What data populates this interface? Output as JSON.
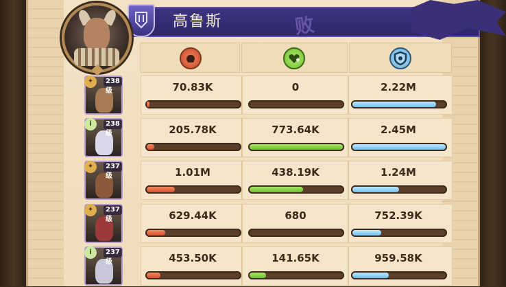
{
  "hero": {
    "name": "高鲁斯",
    "result_glyph": "败"
  },
  "columns": [
    {
      "icon": "damage-fist-icon",
      "color": "#e0593a"
    },
    {
      "icon": "healing-heart-icon",
      "color": "#79c13a"
    },
    {
      "icon": "damage-taken-shield-icon",
      "color": "#5aa9d9"
    }
  ],
  "rows": [
    {
      "level": "238级",
      "faction": "star",
      "damage": "70.83K",
      "damage_ratio": 0.03,
      "healing": "0",
      "healing_ratio": 0.0,
      "taken": "2.22M",
      "taken_ratio": 0.9
    },
    {
      "level": "238级",
      "faction": "1",
      "damage": "205.78K",
      "damage_ratio": 0.08,
      "healing": "773.64K",
      "healing_ratio": 1.0,
      "taken": "2.45M",
      "taken_ratio": 1.0
    },
    {
      "level": "237级",
      "faction": "star",
      "damage": "1.01M",
      "damage_ratio": 0.3,
      "healing": "438.19K",
      "healing_ratio": 0.57,
      "taken": "1.24M",
      "taken_ratio": 0.5
    },
    {
      "level": "237级",
      "faction": "star",
      "damage": "629.44K",
      "damage_ratio": 0.2,
      "healing": "680",
      "healing_ratio": 0.0,
      "taken": "752.39K",
      "taken_ratio": 0.31
    },
    {
      "level": "237级",
      "faction": "1",
      "damage": "453.50K",
      "damage_ratio": 0.15,
      "healing": "141.65K",
      "healing_ratio": 0.18,
      "taken": "959.58K",
      "taken_ratio": 0.39
    }
  ]
}
